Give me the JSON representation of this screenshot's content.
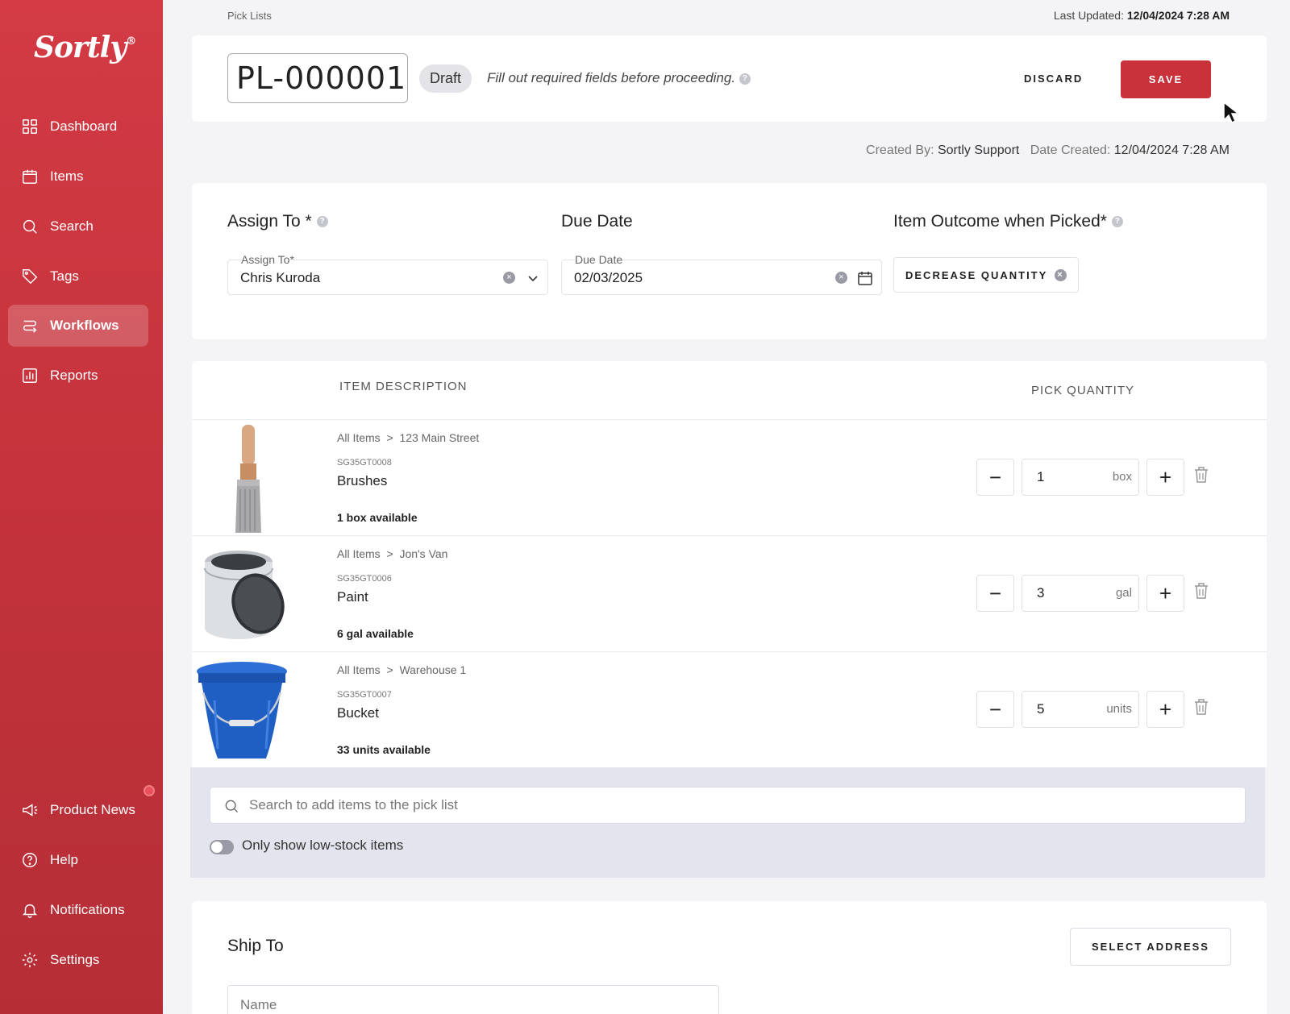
{
  "app": {
    "logo": "Sortly",
    "logo_mark": "®"
  },
  "sidebar": {
    "items": [
      {
        "label": "Dashboard",
        "icon": "dashboard-icon"
      },
      {
        "label": "Items",
        "icon": "items-icon"
      },
      {
        "label": "Search",
        "icon": "search-icon"
      },
      {
        "label": "Tags",
        "icon": "tags-icon"
      },
      {
        "label": "Workflows",
        "icon": "workflows-icon",
        "active": true
      },
      {
        "label": "Reports",
        "icon": "reports-icon"
      }
    ],
    "bottom": [
      {
        "label": "Product News",
        "icon": "megaphone-icon"
      },
      {
        "label": "Help",
        "icon": "help-icon"
      },
      {
        "label": "Notifications",
        "icon": "bell-icon"
      },
      {
        "label": "Settings",
        "icon": "gear-icon"
      }
    ]
  },
  "header": {
    "breadcrumb": "Pick Lists",
    "last_updated_label": "Last Updated:",
    "last_updated_value": "12/04/2024 7:28 AM",
    "pick_list_id": "PL-000001",
    "status": "Draft",
    "hint": "Fill out required fields before proceeding.",
    "discard_label": "DISCARD",
    "save_label": "SAVE"
  },
  "meta": {
    "created_by_label": "Created By:",
    "created_by_value": "Sortly Support",
    "date_created_label": "Date Created:",
    "date_created_value": "12/04/2024 7:28 AM"
  },
  "details": {
    "assign_title": "Assign To *",
    "assign_label": "Assign To*",
    "assign_value": "Chris Kuroda",
    "due_title": "Due Date",
    "due_label": "Due Date",
    "due_value": "02/03/2025",
    "outcome_title": "Item Outcome when Picked*",
    "outcome_value": "DECREASE QUANTITY"
  },
  "table": {
    "col_item": "ITEM DESCRIPTION",
    "col_qty": "PICK QUANTITY",
    "path_root": "All Items",
    "path_sep": ">",
    "rows": [
      {
        "location": "123 Main Street",
        "sku": "SG35GT0008",
        "name": "Brushes",
        "available": "1 box available",
        "qty": "1",
        "unit": "box"
      },
      {
        "location": "Jon's Van",
        "sku": "SG35GT0006",
        "name": "Paint",
        "available": "6 gal available",
        "qty": "3",
        "unit": "gal"
      },
      {
        "location": "Warehouse 1",
        "sku": "SG35GT0007",
        "name": "Bucket",
        "available": "33 units available",
        "qty": "5",
        "unit": "units"
      }
    ]
  },
  "add": {
    "search_placeholder": "Search to add items to the pick list",
    "low_stock_label": "Only show low-stock items"
  },
  "ship": {
    "title": "Ship To",
    "select_address_label": "SELECT ADDRESS",
    "name_placeholder": "Name"
  },
  "colors": {
    "brand": "#c9313b",
    "sidebar": "#c2323a"
  }
}
